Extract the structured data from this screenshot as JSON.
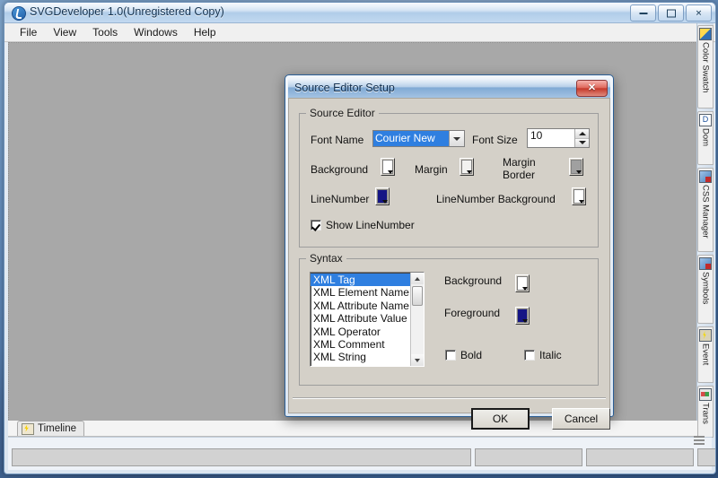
{
  "window": {
    "title": "SVGDeveloper 1.0(Unregistered Copy)",
    "app_icon": "svg-developer-icon",
    "controls": {
      "minimize": "–",
      "maximize": "□",
      "close": "✕"
    }
  },
  "menu": {
    "items": [
      {
        "label": "File"
      },
      {
        "label": "View"
      },
      {
        "label": "Tools"
      },
      {
        "label": "Windows"
      },
      {
        "label": "Help"
      }
    ]
  },
  "dock": {
    "tabs": [
      {
        "label": "Color Swatch",
        "icon": "color-swatch-icon"
      },
      {
        "label": "Dom",
        "icon": "dom-icon",
        "glyph": "D"
      },
      {
        "label": "CSS Manager",
        "icon": "css-manager-icon"
      },
      {
        "label": "Symbols",
        "icon": "symbols-icon"
      },
      {
        "label": "Event",
        "icon": "event-icon"
      },
      {
        "label": "Trans",
        "icon": "transform-icon"
      }
    ]
  },
  "bottom": {
    "timeline_tab": "Timeline",
    "timeline_icon": "timeline-icon"
  },
  "dialog": {
    "title": "Source Editor Setup",
    "close_label": "✕",
    "source_editor": {
      "legend": "Source Editor",
      "font_name_label": "Font Name",
      "font_name_value": "Courier New",
      "font_size_label": "Font Size",
      "font_size_value": "10",
      "swatches": [
        {
          "label": "Background",
          "color": "#ffffff"
        },
        {
          "label": "Margin",
          "color": "#f2f2f0"
        },
        {
          "label": "Margin\nBorder",
          "color": "#a0a0a0"
        },
        {
          "label": "LineNumber",
          "color": "#151585"
        },
        {
          "label": "LineNumber Background",
          "color": "#ffffff"
        }
      ],
      "show_linenumber_label": "Show LineNumber",
      "show_linenumber_checked": true
    },
    "syntax": {
      "legend": "Syntax",
      "items": [
        "XML Tag",
        "XML Element Name",
        "XML Attribute Name",
        "XML Attribute Value",
        "XML Operator",
        "XML Comment",
        "XML String"
      ],
      "selected_index": 0,
      "background_label": "Background",
      "background_color": "#ffffff",
      "foreground_label": "Foreground",
      "foreground_color": "#151585",
      "bold_label": "Bold",
      "bold_checked": false,
      "italic_label": "Italic",
      "italic_checked": false
    },
    "buttons": {
      "ok": "OK",
      "cancel": "Cancel"
    }
  },
  "colors": {
    "accent": "#2f7fe0",
    "navy": "#151585",
    "dialog_face": "#d4d0c8",
    "mdi_client": "#a8a8a8"
  }
}
